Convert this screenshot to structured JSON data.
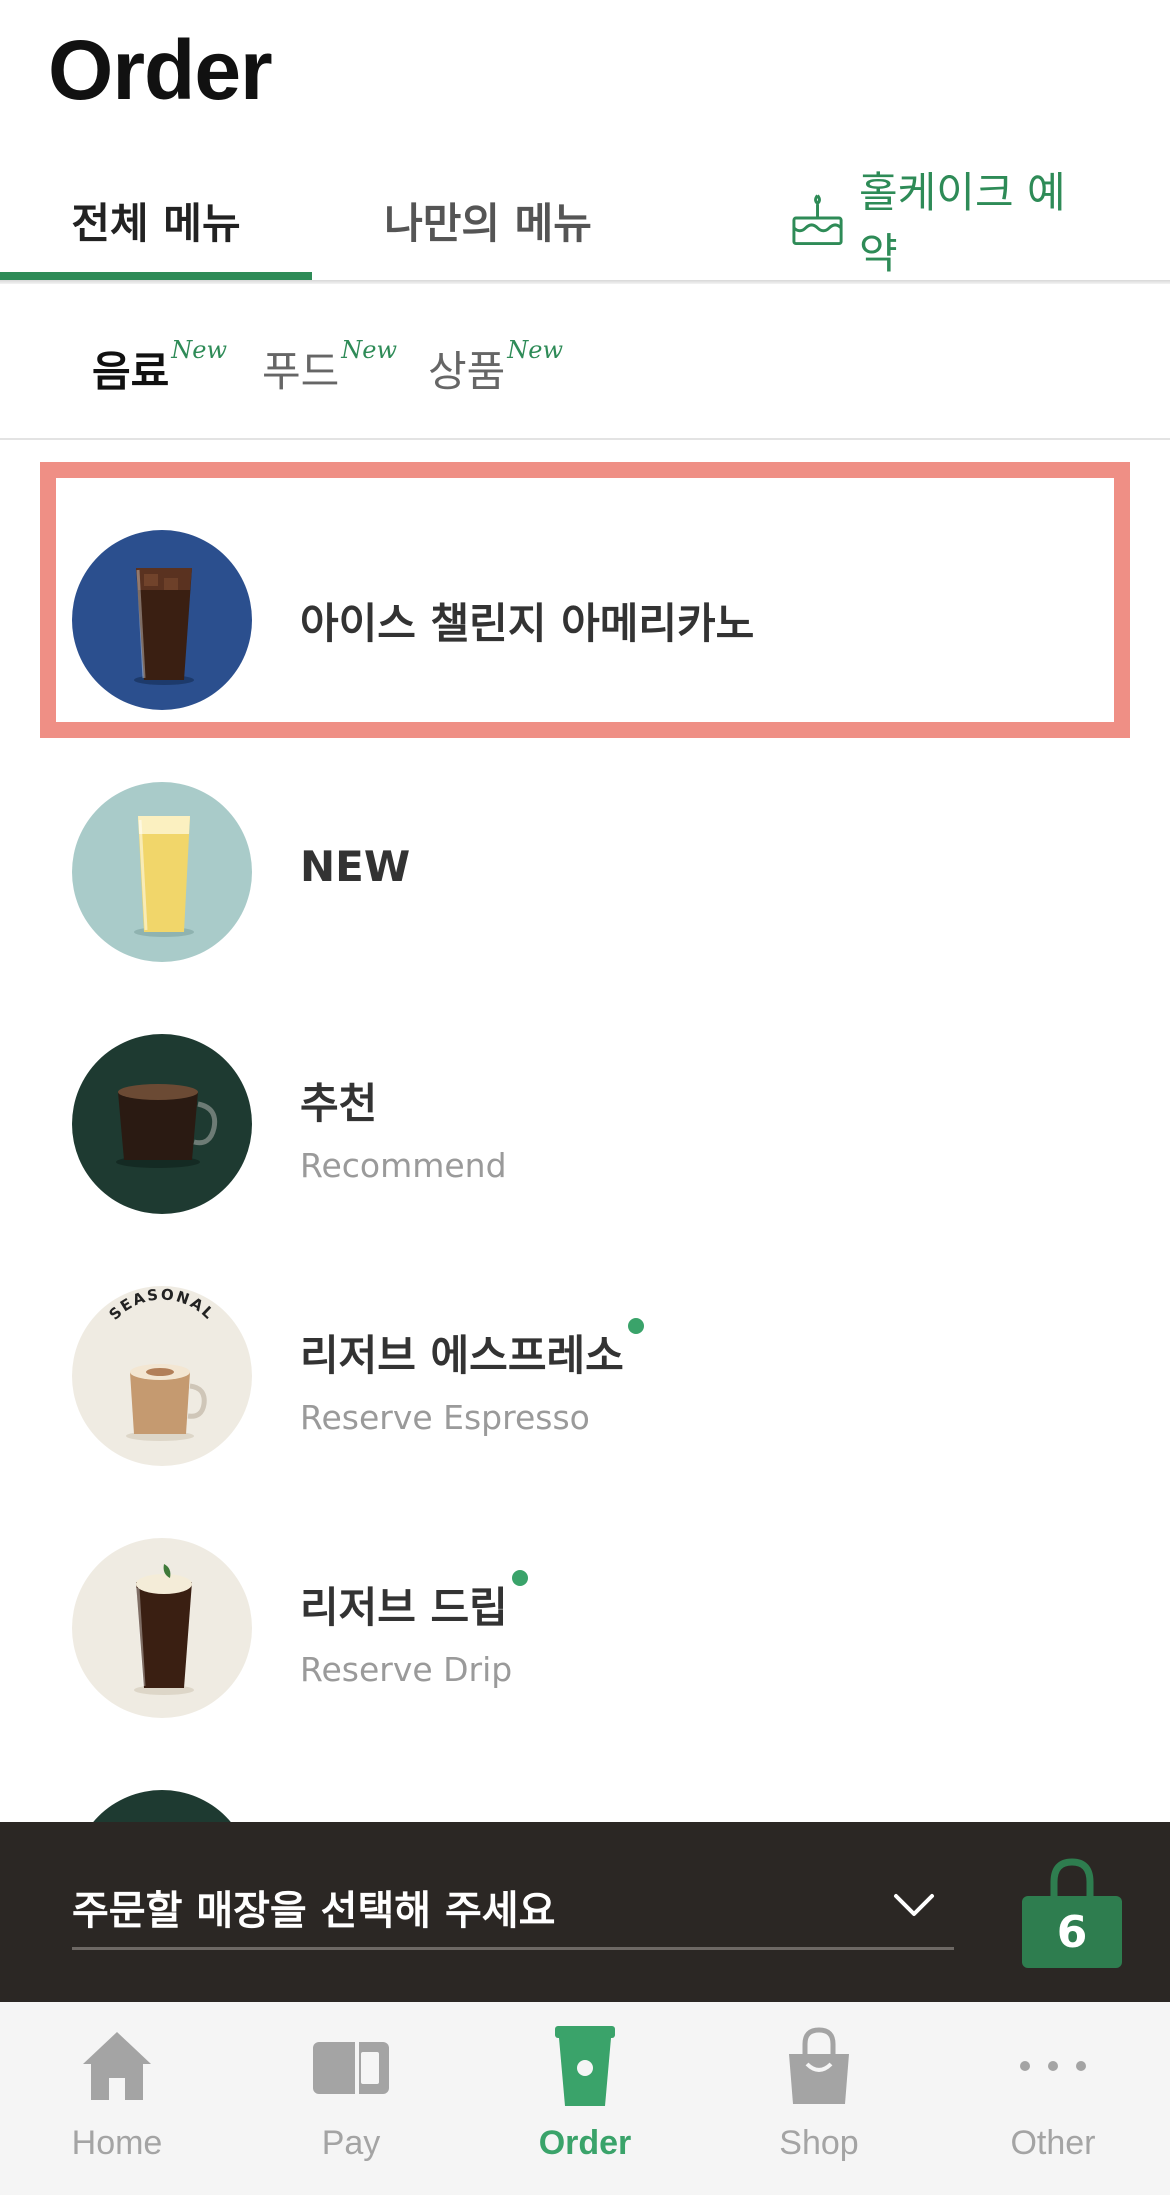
{
  "header": {
    "title": "Order"
  },
  "top_tabs": {
    "all": "전체 메뉴",
    "mine": "나만의 메뉴",
    "cake": "홀케이크 예약"
  },
  "sub_tabs": [
    {
      "label": "음료",
      "badge": "New"
    },
    {
      "label": "푸드",
      "badge": "New"
    },
    {
      "label": "상품",
      "badge": "New"
    }
  ],
  "menu": [
    {
      "title": "아이스 챌린지 아메리카노",
      "subtitle": ""
    },
    {
      "title": "NEW",
      "subtitle": ""
    },
    {
      "title": "추천",
      "subtitle": "Recommend"
    },
    {
      "title": "리저브 에스프레소",
      "subtitle": "Reserve Espresso"
    },
    {
      "title": "리저브 드립",
      "subtitle": "Reserve Drip"
    }
  ],
  "seasonal_badge": "SEASONAL",
  "store_bar": {
    "placeholder": "주문할 매장을 선택해 주세요",
    "cart_count": "6"
  },
  "bottom_nav": [
    {
      "label": "Home",
      "icon": "home-icon"
    },
    {
      "label": "Pay",
      "icon": "card-icon"
    },
    {
      "label": "Order",
      "icon": "cup-icon",
      "active": true
    },
    {
      "label": "Shop",
      "icon": "bag-icon"
    },
    {
      "label": "Other",
      "icon": "more-icon"
    }
  ],
  "colors": {
    "accent": "#2e8b57",
    "nav_active": "#3aa36a",
    "highlight": "#ef8f85",
    "store_bar": "#2b2724"
  }
}
